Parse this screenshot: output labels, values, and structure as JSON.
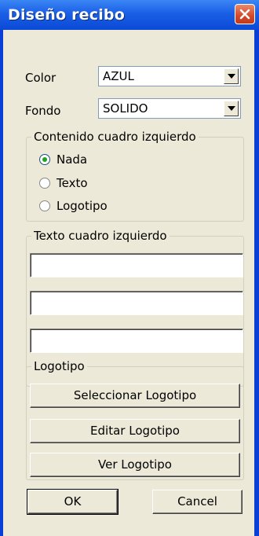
{
  "window": {
    "title": "Diseño recibo"
  },
  "color": {
    "label": "Color",
    "value": "AZUL"
  },
  "fondo": {
    "label": "Fondo",
    "value": "SOLIDO"
  },
  "contenido": {
    "caption": "Contenido cuadro izquierdo",
    "options": [
      "Nada",
      "Texto",
      "Logotipo"
    ],
    "selected": "Nada"
  },
  "texto": {
    "caption": "Texto cuadro izquierdo",
    "lines": [
      "",
      "",
      ""
    ]
  },
  "logotipo": {
    "caption": "Logotipo",
    "select_label": "Seleccionar Logotipo",
    "edit_label": "Editar Logotipo",
    "view_label": "Ver Logotipo"
  },
  "buttons": {
    "ok": "OK",
    "cancel": "Cancel"
  },
  "icons": {
    "close": "close-icon",
    "dropdown": "chevron-down-icon"
  },
  "colors": {
    "titlebar": "#0b49d6",
    "client": "#ece9d8",
    "close": "#d24a2a"
  }
}
